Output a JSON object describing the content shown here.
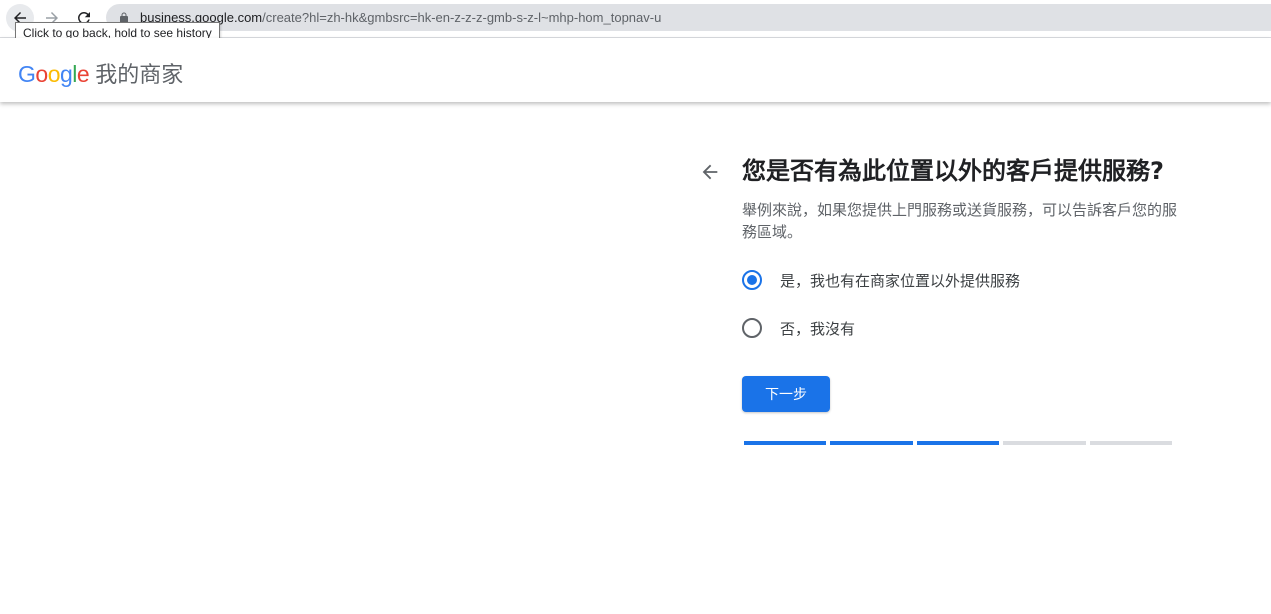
{
  "browser": {
    "url_host": "business.google.com",
    "url_path": "/create?hl=zh-hk&gmbsrc=hk-en-z-z-z-gmb-s-z-l~mhp-hom_topnav-u",
    "tooltip": "Click to go back, hold to see history"
  },
  "header": {
    "logo_letters": [
      "G",
      "o",
      "o",
      "g",
      "l",
      "e"
    ],
    "logo_colors": [
      "#4285F4",
      "#EA4335",
      "#FBBC05",
      "#4285F4",
      "#34A853",
      "#EA4335"
    ],
    "product_name": "我的商家"
  },
  "main": {
    "title": "您是否有為此位置以外的客戶提供服務?",
    "subtitle": "舉例來說，如果您提供上門服務或送貨服務，可以告訴客戶您的服務區域。",
    "options": [
      {
        "label": "是，我也有在商家位置以外提供服務",
        "selected": true
      },
      {
        "label": "否，我沒有",
        "selected": false
      }
    ],
    "next_label": "下一步",
    "progress": {
      "completed_steps": 3,
      "total_steps": 5
    }
  },
  "colors": {
    "accent": "#1a73e8",
    "track": "#dadce0"
  },
  "icons": {
    "back": "arrow-left-icon",
    "forward": "arrow-right-icon",
    "reload": "reload-icon",
    "lock": "lock-icon"
  }
}
